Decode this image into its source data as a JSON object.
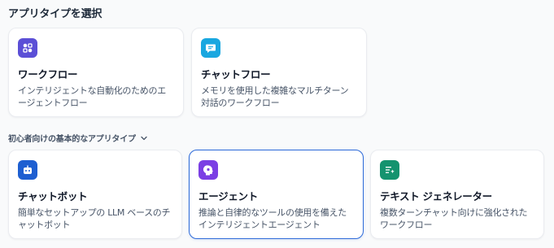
{
  "heading": "アプリタイプを選択",
  "basic_heading": "初心者向けの基本的なアプリタイプ",
  "colors": {
    "workflow_icon": "#5b4fd6",
    "chatflow_icon": "#19a7e0",
    "chatbot_icon": "#1e5fd1",
    "agent_icon": "#7b3fe4",
    "textgen_icon": "#15936f",
    "selected_border": "#2e6bd9"
  },
  "top_cards": [
    {
      "icon": "workflow-icon",
      "title": "ワークフロー",
      "desc": "インテリジェントな自動化のためのエージェントフロー"
    },
    {
      "icon": "chatflow-icon",
      "title": "チャットフロー",
      "desc": "メモリを使用した複雑なマルチターン対話のワークフロー"
    }
  ],
  "basic_cards": [
    {
      "icon": "chatbot-icon",
      "title": "チャットボット",
      "desc": "簡単なセットアップの LLM ベースのチャットボット"
    },
    {
      "icon": "agent-icon",
      "title": "エージェント",
      "desc": "推論と自律的なツールの使用を備えたインテリジェントエージェント",
      "selected": true
    },
    {
      "icon": "text-generator-icon",
      "title": "テキスト ジェネレーター",
      "desc": "複数ターンチャット向けに強化されたワークフロー"
    }
  ]
}
